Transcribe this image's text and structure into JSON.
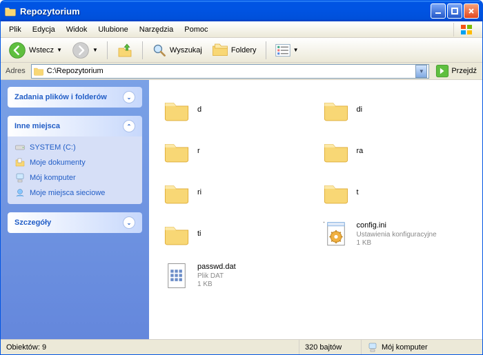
{
  "window": {
    "title": "Repozytorium"
  },
  "menu": {
    "file": "Plik",
    "edit": "Edycja",
    "view": "Widok",
    "favorites": "Ulubione",
    "tools": "Narzędzia",
    "help": "Pomoc"
  },
  "toolbar": {
    "back": "Wstecz",
    "search": "Wyszukaj",
    "folders": "Foldery"
  },
  "address": {
    "label": "Adres",
    "value": "C:\\Repozytorium",
    "go": "Przejdź"
  },
  "sidebar": {
    "tasks": {
      "title": "Zadania plików i folderów"
    },
    "other": {
      "title": "Inne miejsca",
      "links": {
        "system": "SYSTEM (C:)",
        "docs": "Moje dokumenty",
        "computer": "Mój komputer",
        "network": "Moje miejsca sieciowe"
      }
    },
    "details": {
      "title": "Szczegóły"
    }
  },
  "items": {
    "d": {
      "name": "d"
    },
    "di": {
      "name": "di"
    },
    "r": {
      "name": "r"
    },
    "ra": {
      "name": "ra"
    },
    "ri": {
      "name": "ri"
    },
    "t": {
      "name": "t"
    },
    "ti": {
      "name": "ti"
    },
    "config": {
      "name": "config.ini",
      "type": "Ustawienia konfiguracyjne",
      "size": "1 KB"
    },
    "passwd": {
      "name": "passwd.dat",
      "type": "Plik DAT",
      "size": "1 KB"
    }
  },
  "status": {
    "objects": "Obiektów: 9",
    "size": "320 bajtów",
    "location": "Mój komputer"
  }
}
